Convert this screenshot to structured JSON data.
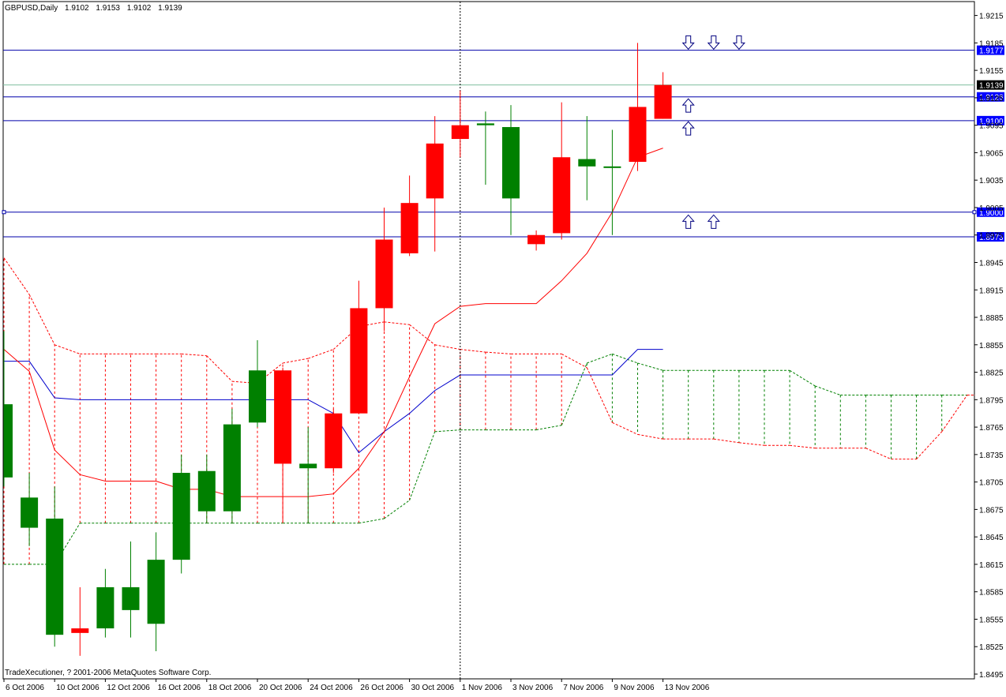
{
  "header": {
    "symbol": "GBPUSD,Daily",
    "open": "1.9102",
    "high": "1.9153",
    "low": "1.9102",
    "close": "1.9139"
  },
  "footer": {
    "copyright": "TradeXecutioner, ? 2001-2006 MetaQuotes Software Corp."
  },
  "colors": {
    "bull": "#008000",
    "bear": "#ff0000",
    "tenkan": "#ff0000",
    "kijun": "#0000cc",
    "level_line": "#0000aa",
    "label_bg": "#0000ff",
    "current_label_bg": "#000000",
    "current_line": "#7fbf9f",
    "arrow_stroke": "#00007f"
  },
  "chart_data": {
    "type": "candlestick",
    "title": "GBPUSD,Daily",
    "ylim": [
      1.8495,
      1.9225
    ],
    "y_ticks": [
      "1.9215",
      "1.9185",
      "1.9155",
      "1.9125",
      "1.9095",
      "1.9065",
      "1.9035",
      "1.9005",
      "1.8975",
      "1.8945",
      "1.8915",
      "1.8885",
      "1.8855",
      "1.8825",
      "1.8795",
      "1.8765",
      "1.8735",
      "1.8705",
      "1.8675",
      "1.8645",
      "1.8615",
      "1.8585",
      "1.8555",
      "1.8525",
      "1.8495"
    ],
    "x_labels": [
      {
        "bar": 0,
        "text": "6 Oct 2006"
      },
      {
        "bar": 2,
        "text": "10 Oct 2006"
      },
      {
        "bar": 4,
        "text": "12 Oct 2006"
      },
      {
        "bar": 6,
        "text": "16 Oct 2006"
      },
      {
        "bar": 8,
        "text": "18 Oct 2006"
      },
      {
        "bar": 10,
        "text": "20 Oct 2006"
      },
      {
        "bar": 12,
        "text": "24 Oct 2006"
      },
      {
        "bar": 14,
        "text": "26 Oct 2006"
      },
      {
        "bar": 16,
        "text": "30 Oct 2006"
      },
      {
        "bar": 18,
        "text": "1 Nov 2006"
      },
      {
        "bar": 20,
        "text": "3 Nov 2006"
      },
      {
        "bar": 22,
        "text": "7 Nov 2006"
      },
      {
        "bar": 24,
        "text": "9 Nov 2006"
      },
      {
        "bar": 26,
        "text": "13 Nov 2006"
      }
    ],
    "candles": [
      {
        "o": 1.871,
        "h": 1.887,
        "l": 1.87,
        "c": 1.879
      },
      {
        "o": 1.8655,
        "h": 1.8715,
        "l": 1.8635,
        "c": 1.8688
      },
      {
        "o": 1.8538,
        "h": 1.87,
        "l": 1.8525,
        "c": 1.8665
      },
      {
        "o": 1.8545,
        "h": 1.859,
        "l": 1.8515,
        "c": 1.854
      },
      {
        "o": 1.8545,
        "h": 1.861,
        "l": 1.8535,
        "c": 1.859
      },
      {
        "o": 1.8565,
        "h": 1.864,
        "l": 1.8535,
        "c": 1.859
      },
      {
        "o": 1.855,
        "h": 1.865,
        "l": 1.852,
        "c": 1.862
      },
      {
        "o": 1.862,
        "h": 1.8735,
        "l": 1.8605,
        "c": 1.8715
      },
      {
        "o": 1.8673,
        "h": 1.8735,
        "l": 1.866,
        "c": 1.8717
      },
      {
        "o": 1.8673,
        "h": 1.8785,
        "l": 1.866,
        "c": 1.8768
      },
      {
        "o": 1.877,
        "h": 1.886,
        "l": 1.8765,
        "c": 1.8827
      },
      {
        "o": 1.8827,
        "h": 1.883,
        "l": 1.866,
        "c": 1.8725
      },
      {
        "o": 1.872,
        "h": 1.8765,
        "l": 1.866,
        "c": 1.8725
      },
      {
        "o": 1.878,
        "h": 1.8785,
        "l": 1.8715,
        "c": 1.872
      },
      {
        "o": 1.8895,
        "h": 1.8925,
        "l": 1.878,
        "c": 1.878
      },
      {
        "o": 1.897,
        "h": 1.9005,
        "l": 1.887,
        "c": 1.8895
      },
      {
        "o": 1.901,
        "h": 1.904,
        "l": 1.8952,
        "c": 1.8955
      },
      {
        "o": 1.9075,
        "h": 1.9105,
        "l": 1.8957,
        "c": 1.9015
      },
      {
        "o": 1.9095,
        "h": 1.9133,
        "l": 1.906,
        "c": 1.908
      },
      {
        "o": 1.9095,
        "h": 1.911,
        "l": 1.903,
        "c": 1.9097
      },
      {
        "o": 1.9015,
        "h": 1.9117,
        "l": 1.8975,
        "c": 1.9093
      },
      {
        "o": 1.8975,
        "h": 1.898,
        "l": 1.8958,
        "c": 1.8965
      },
      {
        "o": 1.906,
        "h": 1.912,
        "l": 1.897,
        "c": 1.8977
      },
      {
        "o": 1.905,
        "h": 1.9105,
        "l": 1.9013,
        "c": 1.9058
      },
      {
        "o": 1.905,
        "h": 1.909,
        "l": 1.8975,
        "c": 1.905
      },
      {
        "o": 1.9115,
        "h": 1.9185,
        "l": 1.9045,
        "c": 1.9055
      },
      {
        "o": 1.9139,
        "h": 1.9153,
        "l": 1.9102,
        "c": 1.9102
      }
    ],
    "tenkan_sen": [
      1.885,
      1.8826,
      1.874,
      1.8713,
      1.8706,
      1.8706,
      1.8706,
      1.8697,
      1.8697,
      1.8689,
      1.8689,
      1.8689,
      1.8689,
      1.8692,
      1.872,
      1.876,
      1.882,
      1.8878,
      1.8897,
      1.89,
      1.89,
      1.89,
      1.8925,
      1.8955,
      1.9,
      1.906,
      1.907
    ],
    "kijun_sen": [
      1.8837,
      1.8837,
      1.8797,
      1.8795,
      1.8795,
      1.8795,
      1.8795,
      1.8795,
      1.8795,
      1.8795,
      1.8795,
      1.8795,
      1.8795,
      1.878,
      1.8737,
      1.876,
      1.878,
      1.8805,
      1.8822,
      1.8822,
      1.8822,
      1.8822,
      1.8822,
      1.8822,
      1.8822,
      1.885,
      1.885
    ],
    "senkou_span_a": [
      1.8615,
      1.8615,
      1.8615,
      1.866,
      1.866,
      1.866,
      1.866,
      1.866,
      1.866,
      1.866,
      1.866,
      1.866,
      1.866,
      1.866,
      1.866,
      1.8665,
      1.8685,
      1.876,
      1.8762,
      1.8762,
      1.8762,
      1.8762,
      1.8767,
      1.8835,
      1.8845,
      1.8835,
      1.8827,
      1.8827,
      1.8827,
      1.8827,
      1.8827,
      1.8827,
      1.881,
      1.88,
      1.88,
      1.88,
      1.88,
      1.88,
      1.88,
      1.88
    ],
    "senkou_span_b": [
      1.895,
      1.891,
      1.8855,
      1.8845,
      1.8845,
      1.8845,
      1.8845,
      1.8845,
      1.8843,
      1.8815,
      1.8813,
      1.8835,
      1.884,
      1.885,
      1.8875,
      1.888,
      1.8877,
      1.8855,
      1.885,
      1.8847,
      1.8845,
      1.8845,
      1.8845,
      1.883,
      1.877,
      1.8757,
      1.8752,
      1.8752,
      1.8752,
      1.8748,
      1.8745,
      1.8745,
      1.8742,
      1.8742,
      1.8742,
      1.873,
      1.873,
      1.876,
      1.88,
      1.88
    ],
    "horizontal_levels": [
      {
        "value": 1.9177,
        "label": "1.9177"
      },
      {
        "value": 1.9126,
        "label": "1.9126"
      },
      {
        "value": 1.91,
        "label": "1.9100"
      },
      {
        "value": 1.9,
        "label": "1.9000"
      },
      {
        "value": 1.8973,
        "label": "1.8973"
      }
    ],
    "current_price": {
      "value": 1.9139,
      "label": "1.9139"
    },
    "vertical_marker_bar": 18,
    "arrows": [
      {
        "bar": 27,
        "price": 1.9185,
        "direction": "down"
      },
      {
        "bar": 28,
        "price": 1.9185,
        "direction": "down"
      },
      {
        "bar": 29,
        "price": 1.9185,
        "direction": "down"
      },
      {
        "bar": 27,
        "price": 1.9117,
        "direction": "up"
      },
      {
        "bar": 27,
        "price": 1.9092,
        "direction": "up"
      },
      {
        "bar": 27,
        "price": 1.899,
        "direction": "up"
      },
      {
        "bar": 28,
        "price": 1.899,
        "direction": "up"
      }
    ]
  }
}
